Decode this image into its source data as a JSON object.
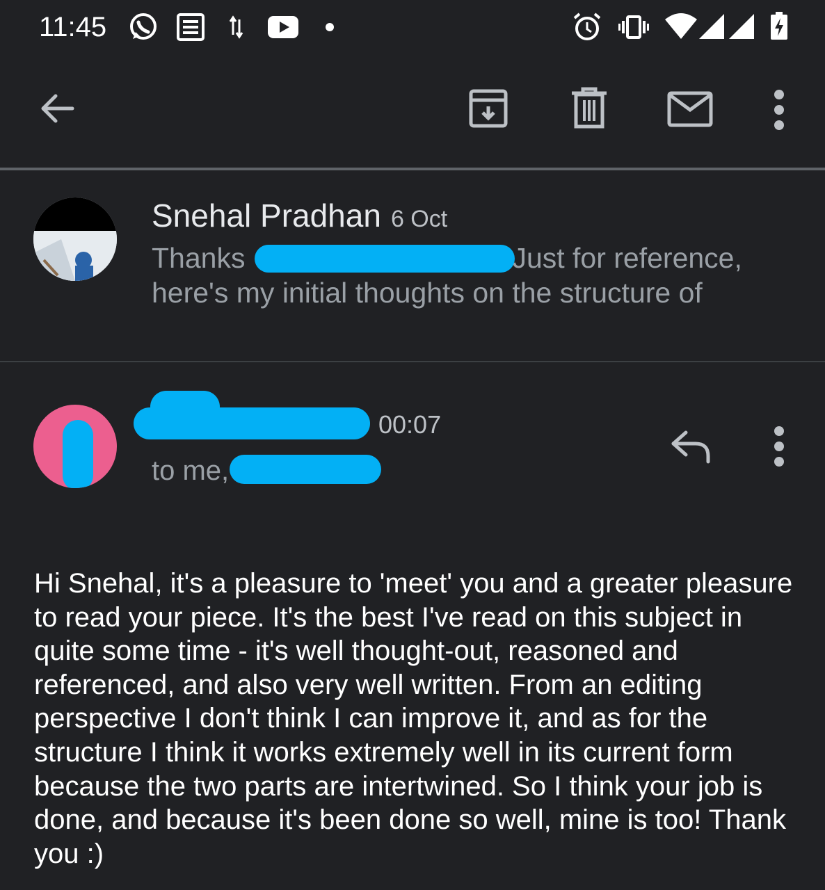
{
  "status_bar": {
    "time": "11:45",
    "icons_left": [
      "whatsapp-icon",
      "news-icon",
      "data-transfer-icon",
      "youtube-icon",
      "dot-icon"
    ],
    "icons_right": [
      "alarm-icon",
      "vibrate-icon",
      "wifi-icon",
      "signal-icon",
      "signal-icon",
      "battery-charging-icon"
    ]
  },
  "toolbar": {
    "actions": [
      "back-arrow-icon",
      "archive-icon",
      "delete-icon",
      "mark-unread-icon",
      "more-vert-icon"
    ]
  },
  "thread": {
    "prev_message": {
      "sender": "Snehal Pradhan",
      "date": "6 Oct",
      "snippet_line1_start": "Thanks",
      "snippet_line1_end": "Just for reference,",
      "snippet_line2": "here's my initial thoughts on the structure of"
    },
    "current_message": {
      "time": "00:07",
      "to_prefix": "to me,",
      "body": "Hi Snehal, it's a pleasure to 'meet' you and a greater pleasure to read your piece. It's the best I've read on this subject in quite some time - it's well thought-out, reasoned and referenced, and also very well written. From an editing perspective I don't think I can improve it, and as for the structure I think it works extremely well in its current form because the two parts are intertwined. So I think your job is done, and because it's been done so well, mine is too! Thank you :)"
    }
  },
  "colors": {
    "background": "#202124",
    "redaction": "#03b0f5",
    "avatar_pink": "#ec5f8f"
  }
}
